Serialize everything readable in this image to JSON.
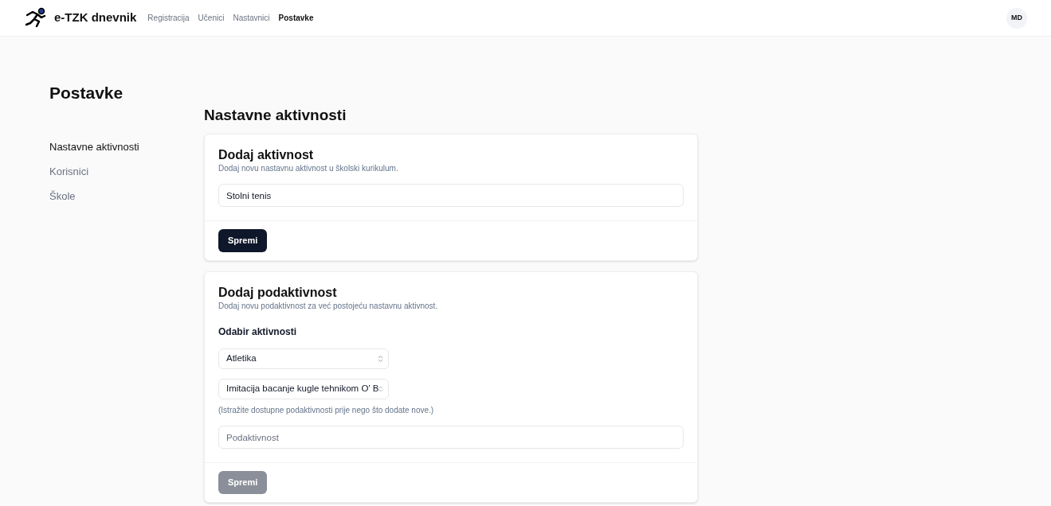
{
  "header": {
    "brand": "e-TZK dnevnik",
    "nav": [
      {
        "label": "Registracija",
        "selected": false
      },
      {
        "label": "Učenici",
        "selected": false
      },
      {
        "label": "Nastavnici",
        "selected": false
      },
      {
        "label": "Postavke",
        "selected": true
      }
    ],
    "avatar": "MD"
  },
  "page_title": "Postavke",
  "sidebar": {
    "items": [
      {
        "label": "Nastavne aktivnosti",
        "selected": true
      },
      {
        "label": "Korisnici",
        "selected": false
      },
      {
        "label": "Škole",
        "selected": false
      }
    ]
  },
  "section_title": "Nastavne aktivnosti",
  "cards": [
    {
      "title": "Dodaj aktivnost",
      "description": "Dodaj novu nastavnu aktivnost u školski kurikulum.",
      "fields": [
        {
          "kind": "input",
          "value": "Stolni tenis"
        }
      ],
      "button": {
        "label": "Spremi",
        "disabled": false
      }
    },
    {
      "title": "Dodaj podaktivnost",
      "description": "Dodaj novu podaktivnost za već postojeću nastavnu aktivnost.",
      "fields": [
        {
          "kind": "label",
          "text": "Odabir aktivnosti"
        },
        {
          "kind": "select",
          "value": "Atletika"
        },
        {
          "kind": "select",
          "value": "Imitacija bacanje kugle tehnikom O’ B"
        },
        {
          "kind": "hint",
          "text": "(Istražite dostupne podaktivnosti prije nego što dodate nove.)"
        },
        {
          "kind": "input",
          "placeholder": "Podaktivnost"
        }
      ],
      "button": {
        "label": "Spremi",
        "disabled": true
      }
    }
  ]
}
